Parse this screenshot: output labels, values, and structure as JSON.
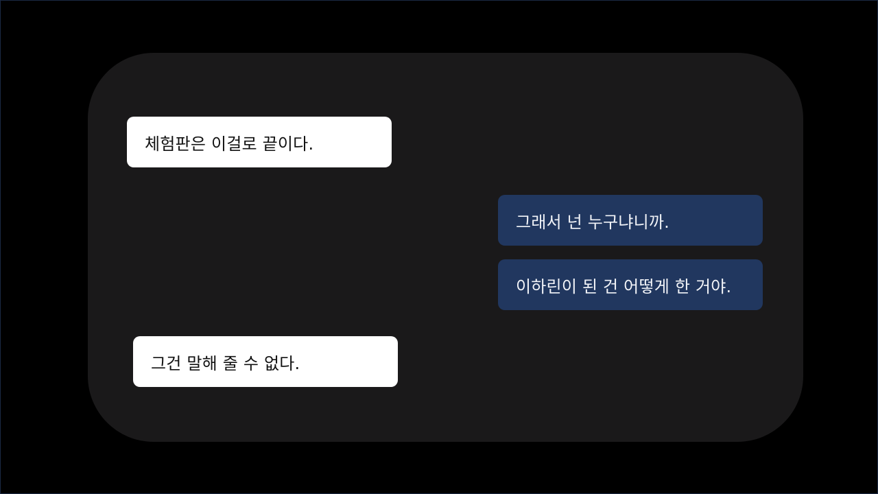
{
  "colors": {
    "background": "#000000",
    "panel": "#1a191a",
    "incoming_bubble": "#ffffff",
    "incoming_text": "#111111",
    "outgoing_bubble": "#21375f",
    "outgoing_text": "#f2f4f8"
  },
  "chat": {
    "messages": [
      {
        "sender": "incoming",
        "text": "체험판은 이걸로 끝이다."
      },
      {
        "sender": "outgoing",
        "text": "그래서 넌 누구냐니까."
      },
      {
        "sender": "outgoing",
        "text": "이하린이 된 건 어떻게 한 거야."
      },
      {
        "sender": "incoming",
        "text": "그건 말해 줄 수 없다."
      }
    ]
  }
}
